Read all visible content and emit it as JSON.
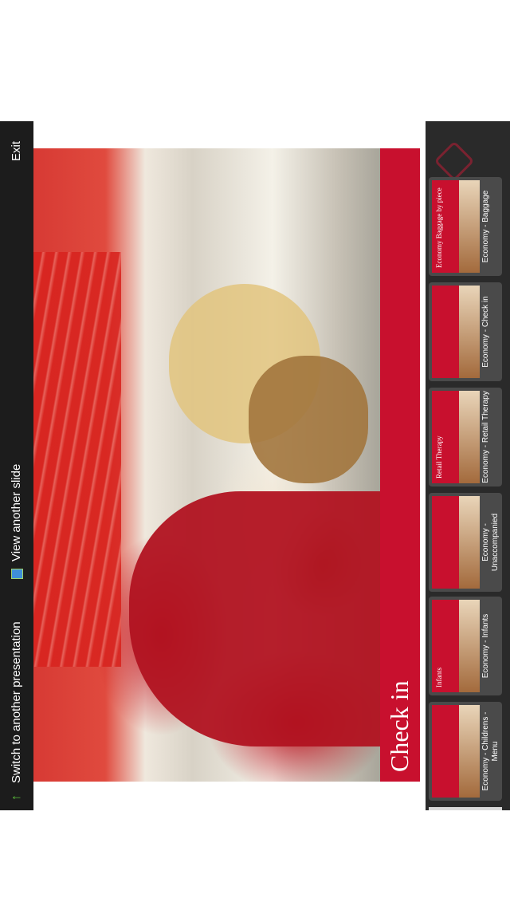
{
  "toolbar": {
    "switch_label": "Switch to another presentation",
    "view_label": "View another slide",
    "exit_label": "Exit"
  },
  "slide": {
    "title": "Check in",
    "accent_color": "#c8102e"
  },
  "thumbnails": [
    {
      "label": "Economy - Childrens - Menu",
      "heading": ""
    },
    {
      "label": "Economy - Infants",
      "heading": "Infants"
    },
    {
      "label": "Economy - Unaccompanied",
      "heading": ""
    },
    {
      "label": "Economy - Retail Therapy",
      "heading": "Retail Therapy"
    },
    {
      "label": "Economy - Check in",
      "heading": ""
    },
    {
      "label": "Economy - Baggage",
      "heading": "Economy Baggage by piece"
    }
  ]
}
